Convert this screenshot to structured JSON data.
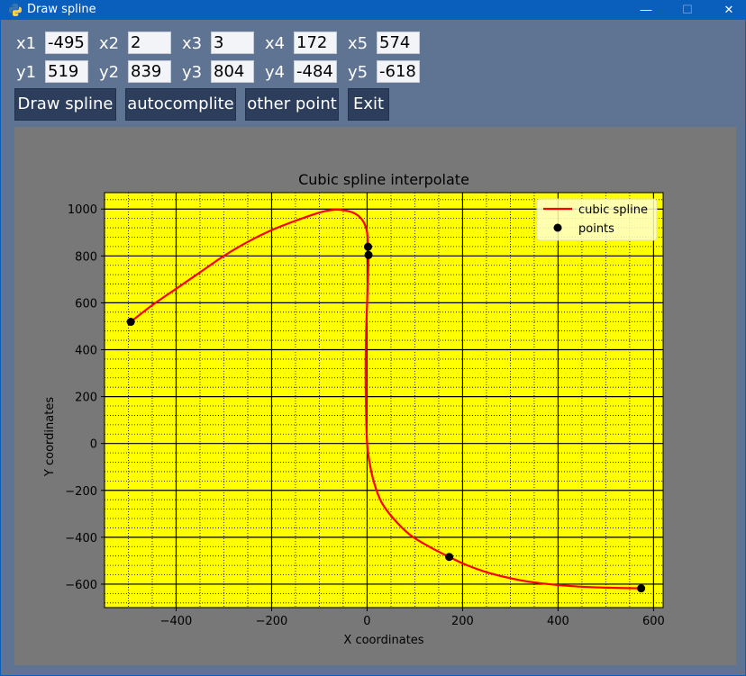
{
  "window": {
    "title": "Draw spline",
    "min_glyph": "—",
    "max_glyph": "☐",
    "close_glyph": "✕"
  },
  "inputs": {
    "x_labels": [
      "x1",
      "x2",
      "x3",
      "x4",
      "x5"
    ],
    "x_values": [
      "-495",
      "2",
      "3",
      "172",
      "574"
    ],
    "y_labels": [
      "y1",
      "y2",
      "y3",
      "y4",
      "y5"
    ],
    "y_values": [
      "519",
      "839",
      "804",
      "-484",
      "-618"
    ]
  },
  "buttons": {
    "draw": "Draw spline",
    "autocomplete": "autocomplite",
    "other_point": "other point",
    "exit": "Exit"
  },
  "chart_data": {
    "type": "line",
    "title": "Cubic spline interpolate",
    "xlabel": "X coordinates",
    "ylabel": "Y coordinates",
    "xlim": [
      -550,
      620
    ],
    "ylim": [
      -700,
      1070
    ],
    "x_ticks": [
      -400,
      -200,
      0,
      200,
      400,
      600
    ],
    "y_ticks": [
      -600,
      -400,
      -200,
      0,
      200,
      400,
      600,
      800,
      1000
    ],
    "x_tick_labels": [
      "−400",
      "−200",
      "0",
      "200",
      "400",
      "600"
    ],
    "y_tick_labels": [
      "−600",
      "−400",
      "−200",
      "0",
      "200",
      "400",
      "600",
      "800",
      "1000"
    ],
    "grid": "major solid, minor dotted",
    "background": "#ffff00",
    "legend_position": "top-right",
    "legend": [
      "cubic spline",
      "points"
    ],
    "series": [
      {
        "name": "cubic spline",
        "color": "#ff0000",
        "x": [
          -495,
          -450,
          -400,
          -350,
          -300,
          -250,
          -200,
          -150,
          -100,
          -70,
          -50,
          -30,
          -15,
          -5,
          0,
          2,
          3,
          2,
          0,
          -2,
          -3,
          -3,
          -2,
          0,
          5,
          15,
          30,
          55,
          90,
          130,
          172,
          210,
          260,
          320,
          380,
          440,
          500,
          574
        ],
        "y": [
          519,
          590,
          660,
          730,
          800,
          860,
          910,
          950,
          985,
          997,
          995,
          985,
          965,
          935,
          900,
          839,
          804,
          720,
          600,
          480,
          360,
          240,
          120,
          0,
          -80,
          -170,
          -250,
          -320,
          -390,
          -440,
          -484,
          -520,
          -555,
          -583,
          -600,
          -610,
          -615,
          -618
        ]
      },
      {
        "name": "points",
        "color": "#000000",
        "x": [
          -495,
          2,
          3,
          172,
          574
        ],
        "y": [
          519,
          839,
          804,
          -484,
          -618
        ]
      }
    ]
  }
}
